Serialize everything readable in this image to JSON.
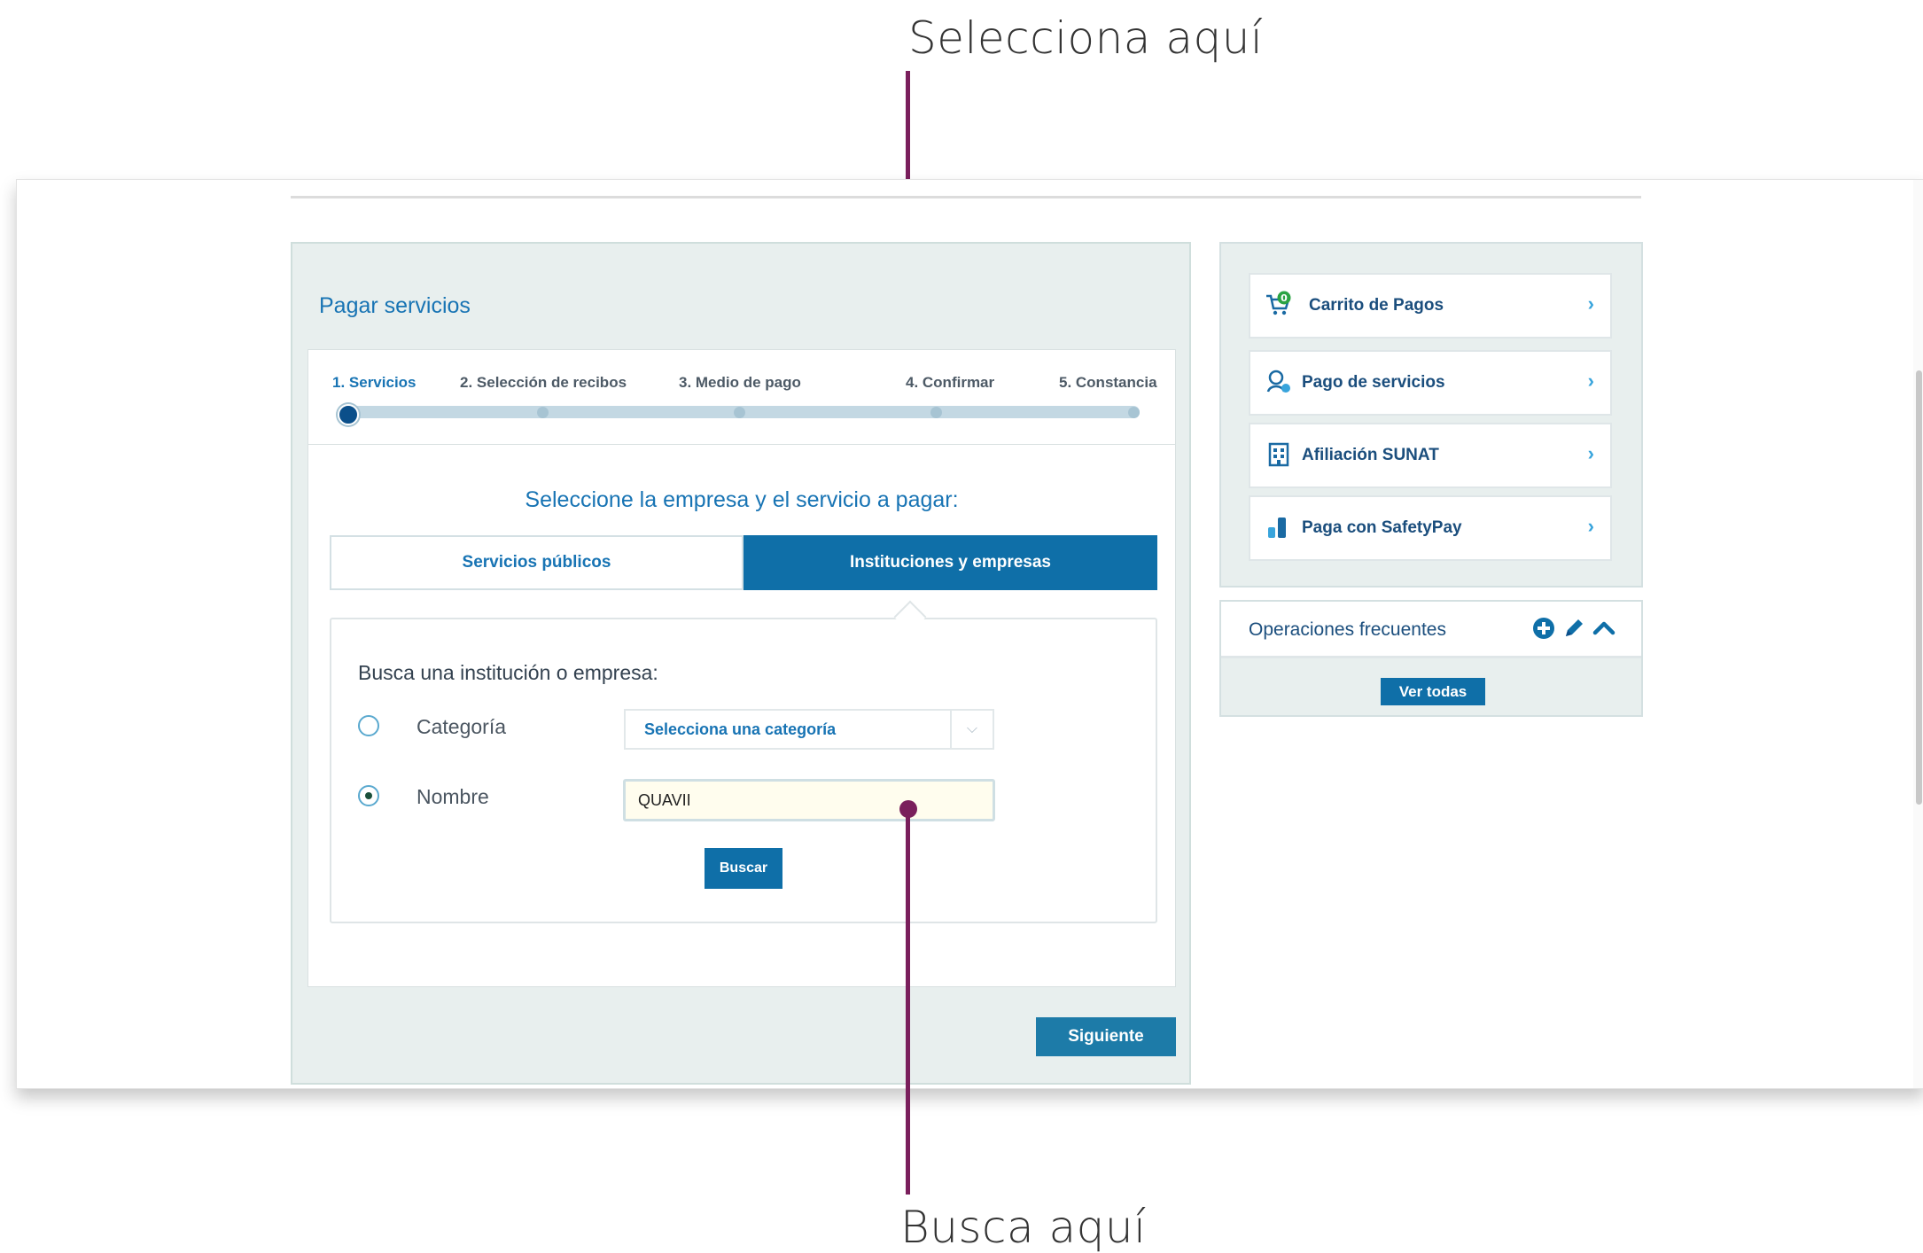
{
  "annotations": {
    "top_label": "Selecciona aquí",
    "bottom_label": "Busca aquí"
  },
  "main": {
    "title": "Pagar servicios",
    "steps": [
      {
        "label": "1. Servicios",
        "active": true
      },
      {
        "label": "2. Selección de recibos",
        "active": false
      },
      {
        "label": "3. Medio de pago",
        "active": false
      },
      {
        "label": "4. Confirmar",
        "active": false
      },
      {
        "label": "5. Constancia",
        "active": false
      }
    ],
    "subtitle": "Seleccione la empresa y el servicio a pagar:",
    "tabs": [
      {
        "label": "Servicios públicos",
        "selected": false
      },
      {
        "label": "Instituciones y empresas",
        "selected": true
      }
    ],
    "search": {
      "label": "Busca una institución o empresa:",
      "category_label": "Categoría",
      "category_placeholder": "Selecciona una categoría",
      "name_label": "Nombre",
      "name_value": "QUAVII",
      "selected_option": "Nombre",
      "search_button": "Buscar"
    },
    "next_button": "Siguiente"
  },
  "sidebar": {
    "items": [
      {
        "label": "Carrito de Pagos",
        "icon": "cart-icon",
        "badge": "0"
      },
      {
        "label": "Pago de servicios",
        "icon": "service-payment-icon"
      },
      {
        "label": "Afiliación SUNAT",
        "icon": "building-icon"
      },
      {
        "label": "Paga con SafetyPay",
        "icon": "safetypay-icon"
      }
    ]
  },
  "frequent": {
    "title": "Operaciones frecuentes",
    "view_all": "Ver todas",
    "icons": [
      "add-icon",
      "edit-icon",
      "collapse-icon"
    ]
  },
  "colors": {
    "primary": "#0f6fa8",
    "link": "#1874b4",
    "panel_bg": "#e8efee",
    "callout": "#7a1f5c",
    "badge": "#2aa343"
  }
}
